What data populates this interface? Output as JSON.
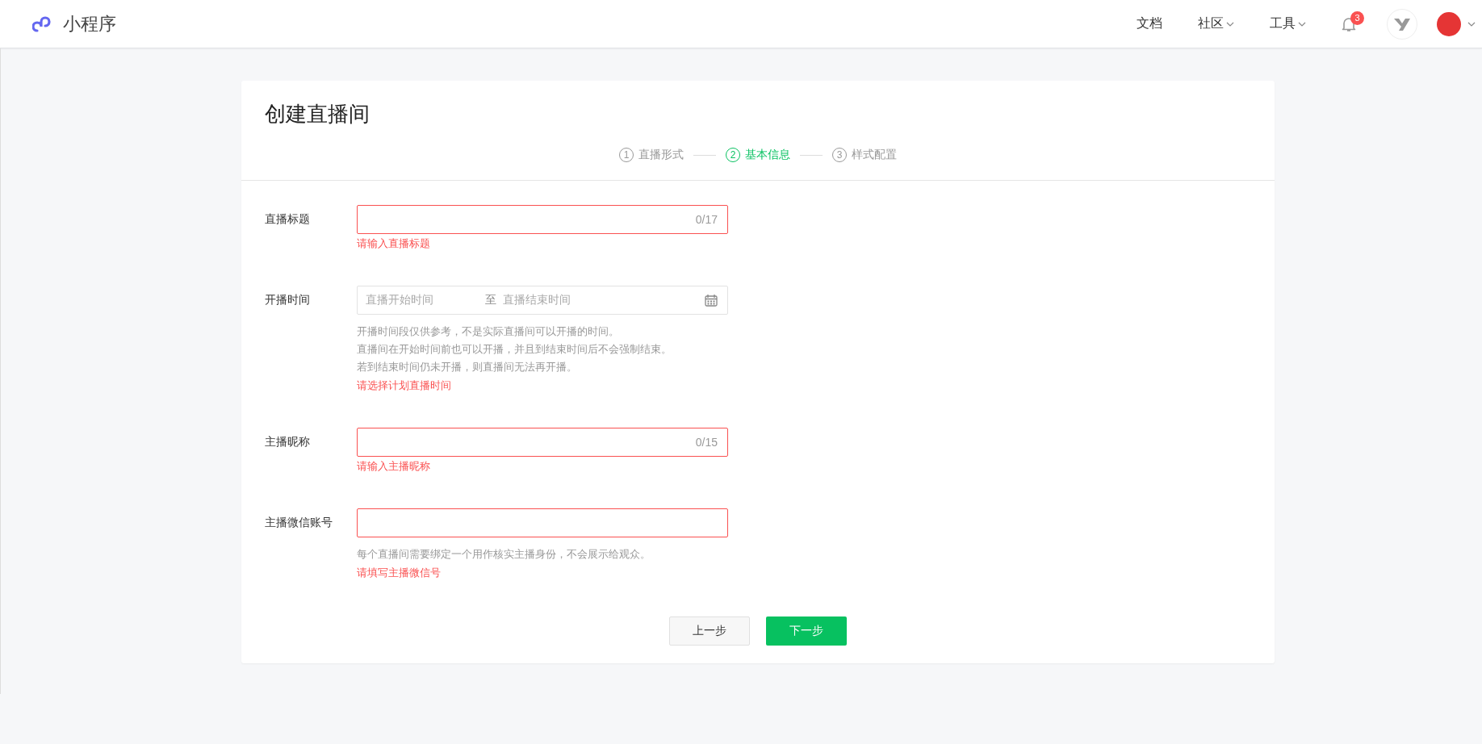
{
  "header": {
    "logo_text": "小程序",
    "nav": [
      {
        "label": "文档",
        "dropdown": false
      },
      {
        "label": "社区",
        "dropdown": true
      },
      {
        "label": "工具",
        "dropdown": true
      }
    ],
    "notification_count": "3"
  },
  "page": {
    "title": "创建直播间",
    "steps": [
      {
        "number": "1",
        "label": "直播形式",
        "selected": false
      },
      {
        "number": "2",
        "label": "基本信息",
        "selected": true
      },
      {
        "number": "3",
        "label": "样式配置",
        "selected": false
      }
    ],
    "fields": [
      {
        "kind": "text",
        "label": "直播标题",
        "counter": "0/17",
        "invalid": true,
        "error": "请输入直播标题"
      },
      {
        "kind": "daterange",
        "label": "开播时间",
        "start_placeholder": "直播开始时间",
        "separator": "至",
        "end_placeholder": "直播结束时间",
        "invalid": false,
        "hints": [
          "开播时间段仅供参考，不是实际直播间可以开播的时间。",
          "直播间在开始时间前也可以开播，并且到结束时间后不会强制结束。",
          "若到结束时间仍未开播，则直播间无法再开播。"
        ],
        "error": "请选择计划直播时间"
      },
      {
        "kind": "text",
        "label": "主播昵称",
        "counter": "0/15",
        "invalid": true,
        "error": "请输入主播昵称"
      },
      {
        "kind": "text",
        "label": "主播微信账号",
        "invalid": true,
        "hints": [
          "每个直播间需要绑定一个用作核实主播身份，不会展示给观众。"
        ],
        "error": "请填写主播微信号"
      }
    ],
    "buttons": [
      {
        "label": "上一步",
        "kind": "secondary"
      },
      {
        "label": "下一步",
        "kind": "primary"
      }
    ]
  }
}
